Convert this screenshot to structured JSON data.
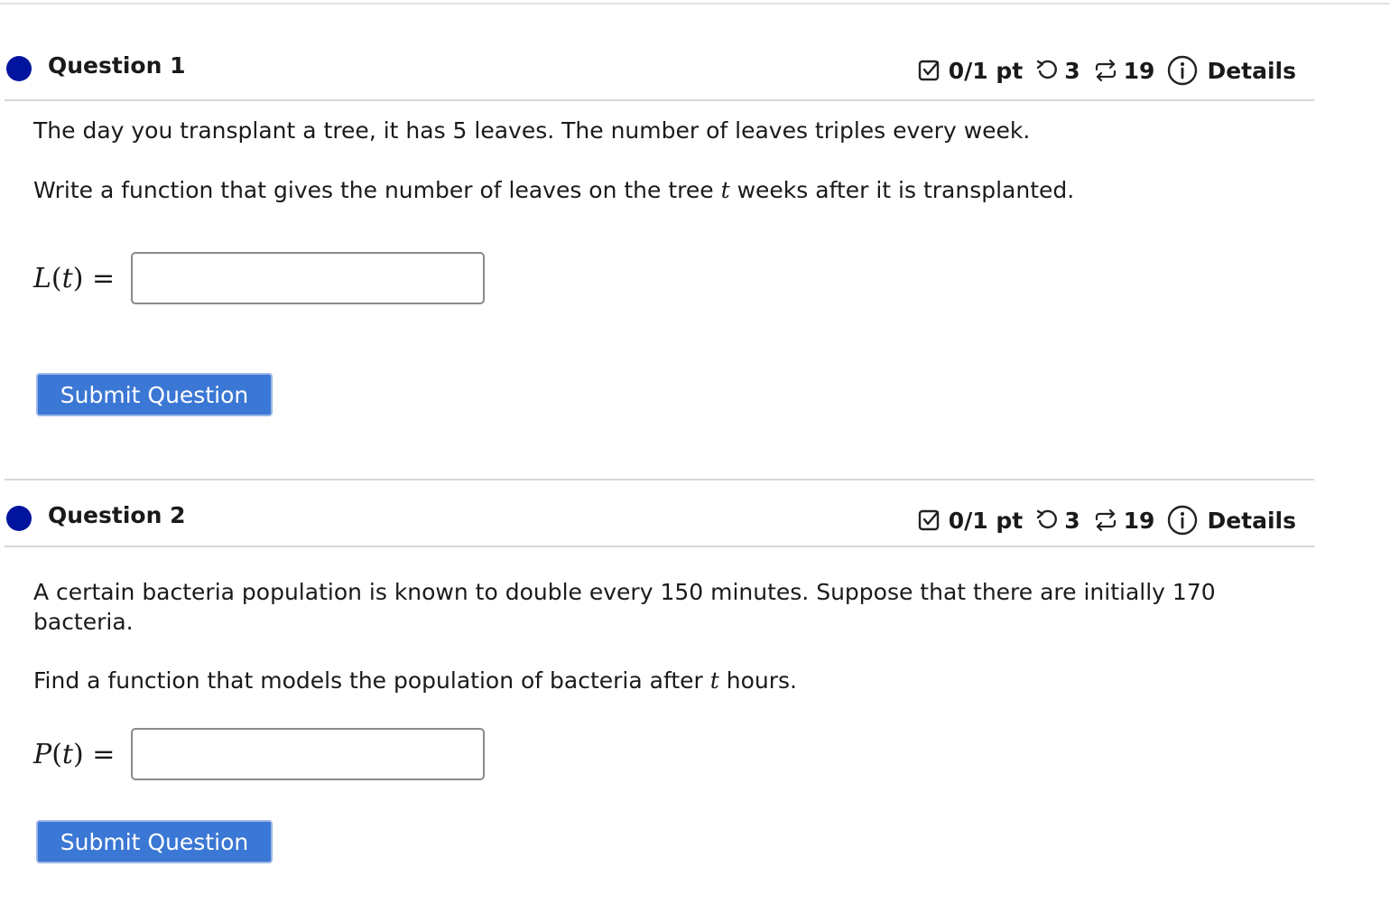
{
  "questions": [
    {
      "title": "Question 1",
      "score": "0/1 pt",
      "tries_left": "3",
      "submissions": "19",
      "details_label": "Details",
      "paragraph1": "The day you transplant a tree, it has 5 leaves. The number of leaves triples every week.",
      "paragraph2_before": "Write a function that gives the number of leaves on the tree ",
      "paragraph2_var": "t",
      "paragraph2_after": " weeks after it is transplanted.",
      "answer_func": "L",
      "answer_var": "t",
      "answer_value": "",
      "submit_label": "Submit Question"
    },
    {
      "title": "Question 2",
      "score": "0/1 pt",
      "tries_left": "3",
      "submissions": "19",
      "details_label": "Details",
      "paragraph1": "A certain bacteria population is known to double every 150 minutes. Suppose that there are initially 170 bacteria.",
      "paragraph2_before": "Find a function that models the population of bacteria after ",
      "paragraph2_var": "t",
      "paragraph2_after": " hours.",
      "answer_func": "P",
      "answer_var": "t",
      "answer_value": "",
      "submit_label": "Submit Question"
    }
  ],
  "colors": {
    "status_dot": "#00149e",
    "submit_button": "#3b77d4",
    "separator": "#d6d6d6"
  },
  "icons": {
    "score": "checkbox-icon",
    "tries": "retry-icon",
    "submissions": "cycle-arrows-icon",
    "details": "info-icon"
  }
}
